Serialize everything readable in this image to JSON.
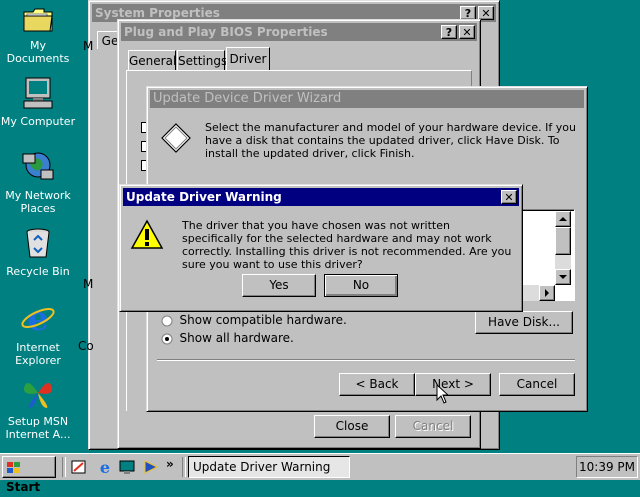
{
  "desktop": {
    "icons": [
      {
        "label": "My Documents",
        "icon": "folder-icon"
      },
      {
        "label": "My Computer",
        "icon": "computer-icon"
      },
      {
        "label": "My Network Places",
        "icon": "network-icon"
      },
      {
        "label": "Recycle Bin",
        "icon": "recycle-bin-icon"
      },
      {
        "label": "Internet Explorer",
        "icon": "ie-icon"
      },
      {
        "label": "Setup MSN Internet A...",
        "icon": "msn-butterfly-icon"
      }
    ]
  },
  "system_properties": {
    "title": "System Properties",
    "tab_fragment": "Ge",
    "side_letters": [
      "M",
      "M",
      "Co"
    ],
    "help_button": "?",
    "close_button": "✕"
  },
  "pnp_bios": {
    "title": "Plug and Play BIOS Properties",
    "help_button": "?",
    "close_button": "✕",
    "tabs": [
      "General",
      "Settings",
      "Driver"
    ],
    "active_tab": "Driver",
    "close_label": "Close",
    "cancel_label": "Cancel"
  },
  "wizard": {
    "title": "Update Device Driver Wizard",
    "instructions": "Select the manufacturer and model of your hardware device. If you have a disk that contains the updated driver, click Have Disk. To install the updated driver, click Finish.",
    "radio_compatible": "Show compatible hardware.",
    "radio_all": "Show all hardware.",
    "selected_radio": "Show all hardware.",
    "have_disk_label": "Have Disk...",
    "back_label": "< Back",
    "next_label": "Next >",
    "cancel_label": "Cancel"
  },
  "warning": {
    "title": "Update Driver Warning",
    "message": "The driver that you have chosen was not written specifically for the selected hardware and may not work correctly.  Installing this driver is not recommended.  Are you sure you want to use this driver?",
    "yes_label": "Yes",
    "no_label": "No",
    "close_button": "✕"
  },
  "taskbar": {
    "start_label": "Start",
    "overflow": "»",
    "active_task": "Update Driver Warning",
    "clock": "10:39 PM"
  }
}
